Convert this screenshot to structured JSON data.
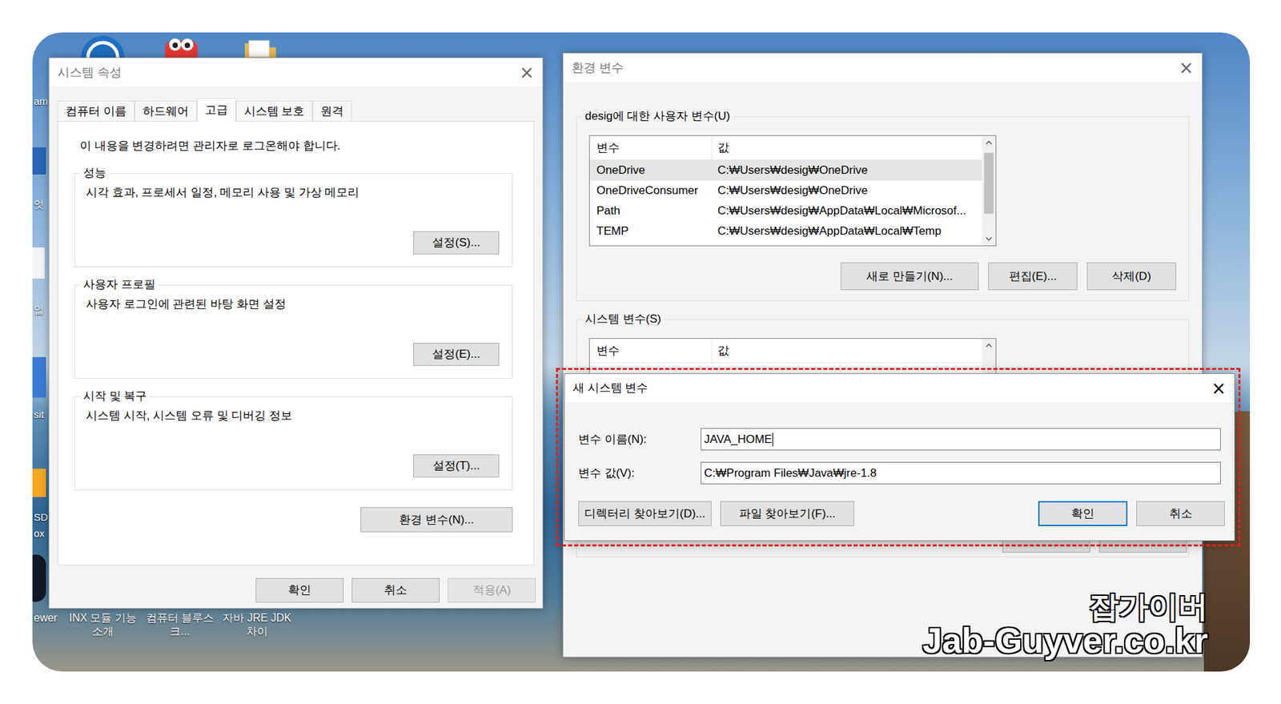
{
  "desktop": {
    "edge_labels": [
      "am",
      "엇",
      "업",
      "sit",
      "SD",
      "ox"
    ],
    "icons": [
      {
        "label": "ewer"
      },
      {
        "label": "INX 모듈 기능 소개"
      },
      {
        "label": "컴퓨터 블루스크..."
      },
      {
        "label": "자바 JRE JDK 차이"
      }
    ]
  },
  "system_properties": {
    "title": "시스템 속성",
    "close": "×",
    "tabs": [
      {
        "label": "컴퓨터 이름",
        "selected": false
      },
      {
        "label": "하드웨어",
        "selected": false
      },
      {
        "label": "고급",
        "selected": true
      },
      {
        "label": "시스템 보호",
        "selected": false
      },
      {
        "label": "원격",
        "selected": false
      }
    ],
    "notice": "이 내용을 변경하려면 관리자로 로그온해야 합니다.",
    "groups": [
      {
        "title": "성능",
        "description": "시각 효과, 프로세서 일정, 메모리 사용 및 가상 메모리",
        "button": "설정(S)..."
      },
      {
        "title": "사용자 프로필",
        "description": "사용자 로그인에 관련된 바탕 화면 설정",
        "button": "설정(E)..."
      },
      {
        "title": "시작 및 복구",
        "description": "시스템 시작, 시스템 오류 및 디버깅 정보",
        "button": "설정(T)..."
      }
    ],
    "environment_button": "환경 변수(N)...",
    "buttons": [
      {
        "label": "확인",
        "disabled": false
      },
      {
        "label": "취소",
        "disabled": false
      },
      {
        "label": "적용(A)",
        "disabled": true
      }
    ]
  },
  "environment_variables": {
    "title": "환경 변수",
    "close": "×",
    "user_variables": {
      "title": "desig에 대한 사용자 변수(U)",
      "columns": [
        "변수",
        "값"
      ],
      "rows": [
        {
          "name": "OneDrive",
          "value": "C:₩Users₩desig₩OneDrive",
          "selected": true
        },
        {
          "name": "OneDriveConsumer",
          "value": "C:₩Users₩desig₩OneDrive",
          "selected": false
        },
        {
          "name": "Path",
          "value": "C:₩Users₩desig₩AppData₩Local₩Microsof...",
          "selected": false
        },
        {
          "name": "TEMP",
          "value": "C:₩Users₩desig₩AppData₩Local₩Temp",
          "selected": false
        }
      ],
      "buttons": [
        "새로 만들기(N)...",
        "편집(E)...",
        "삭제(D)"
      ]
    },
    "system_variables": {
      "title": "시스템 변수(S)",
      "columns": [
        "변수",
        "값"
      ]
    }
  },
  "new_variable": {
    "title": "새 시스템 변수",
    "close": "×",
    "fields": [
      {
        "label": "변수 이름(N):",
        "value": "JAVA_HOME",
        "focused": true
      },
      {
        "label": "변수 값(V):",
        "value": "C:₩Program Files₩Java₩jre-1.8",
        "focused": false
      }
    ],
    "buttons": [
      {
        "label": "디렉터리 찾아보기(D)...",
        "default": false
      },
      {
        "label": "파일 찾아보기(F)...",
        "default": false
      },
      {
        "label": "확인",
        "default": true
      },
      {
        "label": "취소",
        "default": false
      }
    ]
  },
  "watermark": {
    "name": "잡가이버",
    "url": "Jab-Guyver.co.kr"
  }
}
